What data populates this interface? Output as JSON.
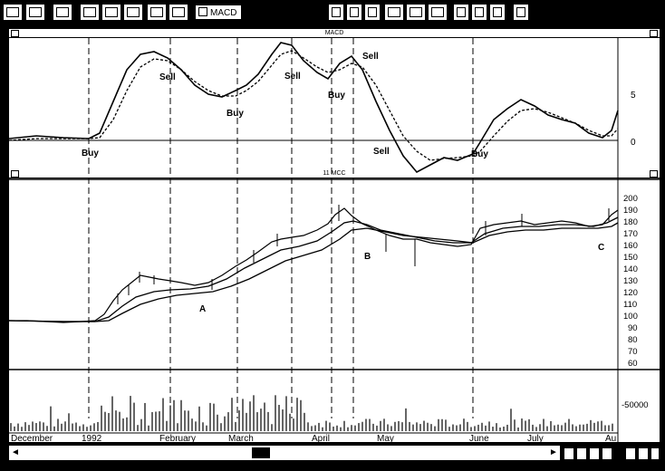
{
  "toolbar": {
    "macd_toggle_label": "MACD"
  },
  "macd_pane": {
    "title": "MACD",
    "y_labels": [
      "5",
      "0"
    ],
    "signals": [
      {
        "label": "Buy"
      },
      {
        "label": "Sell"
      },
      {
        "label": "Buy"
      },
      {
        "label": "Sell"
      },
      {
        "label": "Buy"
      },
      {
        "label": "Sell"
      },
      {
        "label": "Sell"
      },
      {
        "label": "Buy"
      }
    ]
  },
  "price_pane": {
    "title": "11 MCC",
    "y_labels": [
      "200",
      "190",
      "180",
      "170",
      "160",
      "150",
      "140",
      "130",
      "120",
      "110",
      "100",
      "90",
      "80",
      "70",
      "60"
    ],
    "annotations": [
      "A",
      "B",
      "C"
    ]
  },
  "volume_pane": {
    "y_label": "50000",
    "y_label_right": "-50000"
  },
  "date_axis": {
    "labels": [
      "December",
      "1992",
      "February",
      "March",
      "April",
      "May",
      "June",
      "July",
      "Au"
    ]
  },
  "colors": {
    "background": "#000000",
    "panel": "#ffffff",
    "ink": "#000000"
  },
  "icons": [
    "pointer-icon",
    "open-icon",
    "save-icon",
    "print-icon",
    "chart-icon",
    "tool-icon",
    "zoom-icon",
    "grid-icon",
    "line-icon",
    "bar-icon",
    "window-icon",
    "arrow-left-icon",
    "arrow-right-icon"
  ]
}
